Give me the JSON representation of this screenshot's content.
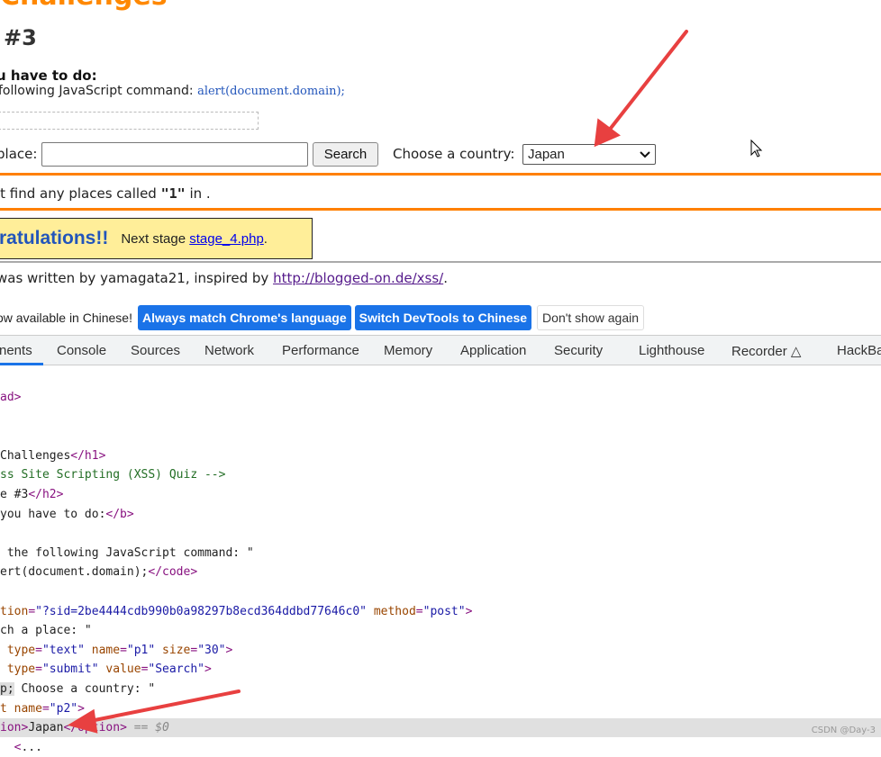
{
  "page": {
    "title": "Challenges",
    "stage": "#3",
    "todo": "u have to do:",
    "cmd_prefix": "following JavaScript command: ",
    "cmd_code": "alert(document.domain);",
    "place_label": "place:",
    "place_value": "",
    "search_label": "Search",
    "country_label": "Choose a country:",
    "country_value": "Japan",
    "result_pre": "'t find any places called ",
    "result_q": "\"1\"",
    "result_post": " in .",
    "congrats": "ratulations!!",
    "next_pre": "Next stage ",
    "next_link": "stage_4.php",
    "next_post": ".",
    "credit_pre": "was written by yamagata21, inspired by ",
    "credit_link": "http://blogged-on.de/xss/",
    "credit_post": "."
  },
  "devtools": {
    "banner_text": "ow available in Chinese!",
    "btn_match": "Always match Chrome's language",
    "btn_switch": "Switch DevTools to Chinese",
    "btn_dont": "Don't show again",
    "tabs": [
      "nents",
      "Console",
      "Sources",
      "Network",
      "Performance",
      "Memory",
      "Application",
      "Security",
      "Lighthouse",
      "Recorder",
      "HackBa"
    ],
    "code": [
      [
        [
          "t",
          "ad>"
        ]
      ],
      [],
      [],
      [
        [
          "tx",
          "Challenges"
        ],
        [
          "t",
          "</h1>"
        ]
      ],
      [
        [
          "cm",
          "ss Site Scripting (XSS) Quiz -->"
        ]
      ],
      [
        [
          "tx",
          "e #3"
        ],
        [
          "t",
          "</h2>"
        ]
      ],
      [
        [
          "tx",
          "you have to do:"
        ],
        [
          "t",
          "</b>"
        ]
      ],
      [],
      [
        [
          "tx",
          " the following JavaScript command: \""
        ]
      ],
      [
        [
          "tx",
          "ert(document.domain);"
        ],
        [
          "t",
          "</code>"
        ]
      ],
      [],
      [
        [
          "an",
          "tion"
        ],
        [
          "t",
          "="
        ],
        [
          "av",
          "\"?sid=2be4444cdb990b0a98297b8ecd364ddbd77646c0\""
        ],
        [
          "an",
          " method"
        ],
        [
          "t",
          "="
        ],
        [
          "av",
          "\"post\""
        ],
        [
          "t",
          ">"
        ]
      ],
      [
        [
          "tx",
          "ch a place: \""
        ]
      ],
      [
        [
          "an",
          " type"
        ],
        [
          "t",
          "="
        ],
        [
          "av",
          "\"text\""
        ],
        [
          "an",
          " name"
        ],
        [
          "t",
          "="
        ],
        [
          "av",
          "\"p1\""
        ],
        [
          "an",
          " size"
        ],
        [
          "t",
          "="
        ],
        [
          "av",
          "\"30\""
        ],
        [
          "t",
          ">"
        ]
      ],
      [
        [
          "an",
          " type"
        ],
        [
          "t",
          "="
        ],
        [
          "av",
          "\"submit\""
        ],
        [
          "an",
          " value"
        ],
        [
          "t",
          "="
        ],
        [
          "av",
          "\"Search\""
        ],
        [
          "t",
          ">"
        ]
      ],
      [
        [
          "ent",
          "p;"
        ],
        [
          "tx",
          " Choose a country: \""
        ]
      ],
      [
        [
          "an",
          "t name"
        ],
        [
          "t",
          "="
        ],
        [
          "av",
          "\"p2\""
        ],
        [
          "t",
          ">"
        ]
      ],
      [
        [
          "t",
          "ion>"
        ],
        [
          "tx",
          "Japan"
        ],
        [
          "t",
          "</option>"
        ],
        [
          "dim",
          " == $0"
        ]
      ],
      [
        [
          "tx",
          "  "
        ],
        [
          "t",
          "<"
        ],
        [
          "tx",
          "..."
        ]
      ]
    ]
  },
  "watermark": "CSDN @Day-3",
  "colors": {
    "accent": "#ff8000",
    "devtools_blue": "#1a73e8",
    "arrow": "#e84040"
  }
}
